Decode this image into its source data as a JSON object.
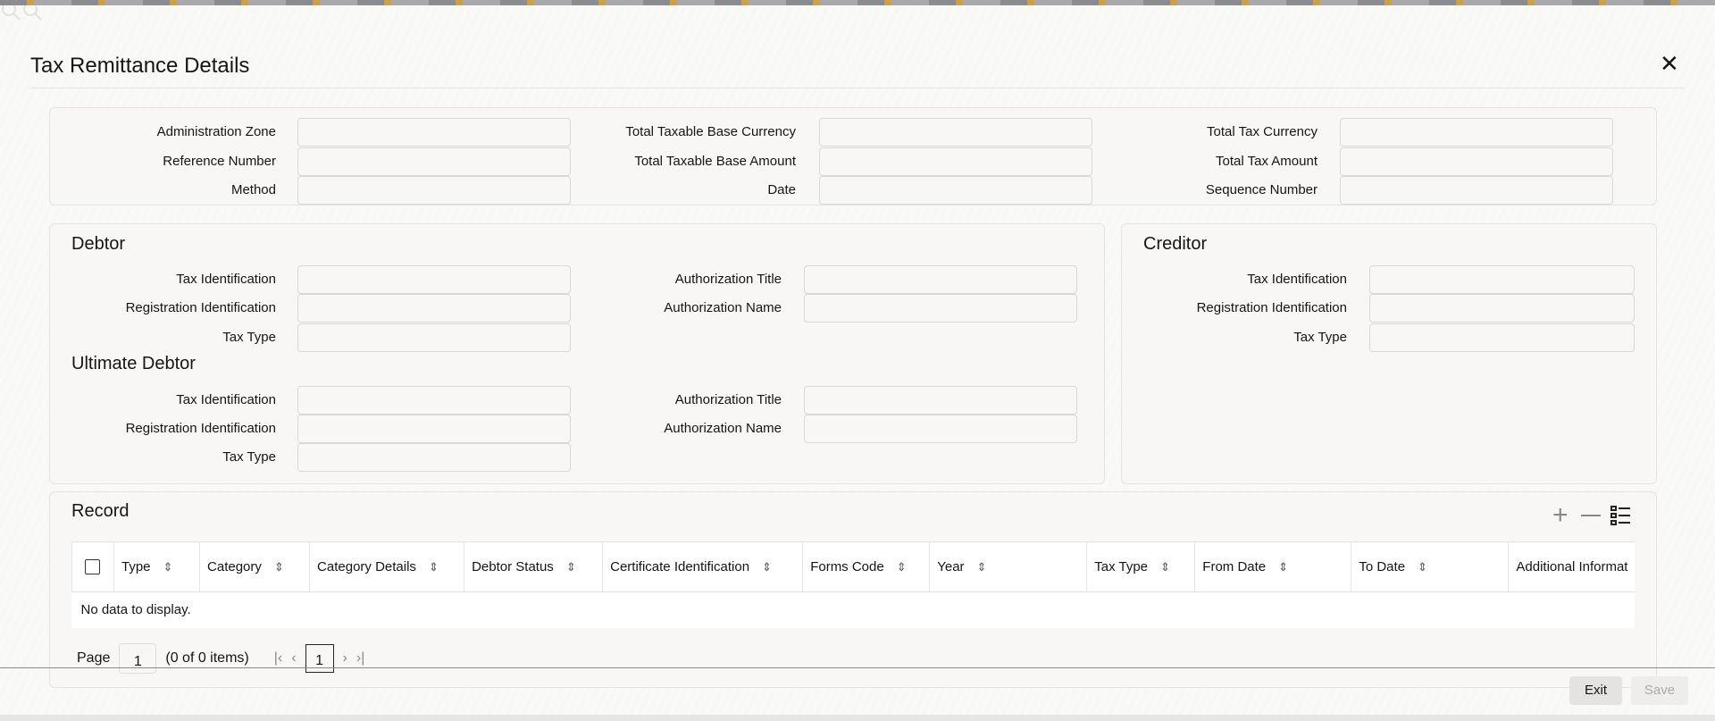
{
  "dialog": {
    "title": "Tax Remittance Details",
    "close_icon": "close-icon"
  },
  "header_fields": [
    {
      "label": "Administration Zone",
      "value": ""
    },
    {
      "label": "Reference Number",
      "value": ""
    },
    {
      "label": "Method",
      "value": ""
    },
    {
      "label": "Total Taxable Base Currency",
      "value": "",
      "lookup": true
    },
    {
      "label": "Total Taxable Base Amount",
      "value": ""
    },
    {
      "label": "Date",
      "value": ""
    },
    {
      "label": "Total Tax Currency",
      "value": "",
      "lookup": true
    },
    {
      "label": "Total Tax Amount",
      "value": ""
    },
    {
      "label": "Sequence Number",
      "value": ""
    }
  ],
  "debtor": {
    "title": "Debtor",
    "fields": [
      {
        "label": "Tax Identification",
        "value": ""
      },
      {
        "label": "Registration Identification",
        "value": ""
      },
      {
        "label": "Tax Type",
        "value": ""
      },
      {
        "label": "Authorization Title",
        "value": ""
      },
      {
        "label": "Authorization Name",
        "value": ""
      }
    ]
  },
  "ultimate_debtor": {
    "title": "Ultimate Debtor",
    "fields": [
      {
        "label": "Tax Identification",
        "value": ""
      },
      {
        "label": "Registration Identification",
        "value": ""
      },
      {
        "label": "Tax Type",
        "value": ""
      },
      {
        "label": "Authorization Title",
        "value": ""
      },
      {
        "label": "Authorization Name",
        "value": ""
      }
    ]
  },
  "creditor": {
    "title": "Creditor",
    "fields": [
      {
        "label": "Tax Identification",
        "value": ""
      },
      {
        "label": "Registration Identification",
        "value": ""
      },
      {
        "label": "Tax Type",
        "value": ""
      }
    ]
  },
  "record": {
    "title": "Record",
    "columns": [
      "Type",
      "Category",
      "Category Details",
      "Debtor Status",
      "Certificate Identification",
      "Forms Code",
      "Year",
      "Tax Type",
      "From Date",
      "To Date",
      "Additional Informat"
    ],
    "empty_text": "No data to display.",
    "pagination": {
      "page_label": "Page",
      "page_value": "1",
      "items_text": "(0 of 0 items)",
      "current_page": "1"
    }
  },
  "footer": {
    "exit_label": "Exit",
    "save_label": "Save"
  }
}
